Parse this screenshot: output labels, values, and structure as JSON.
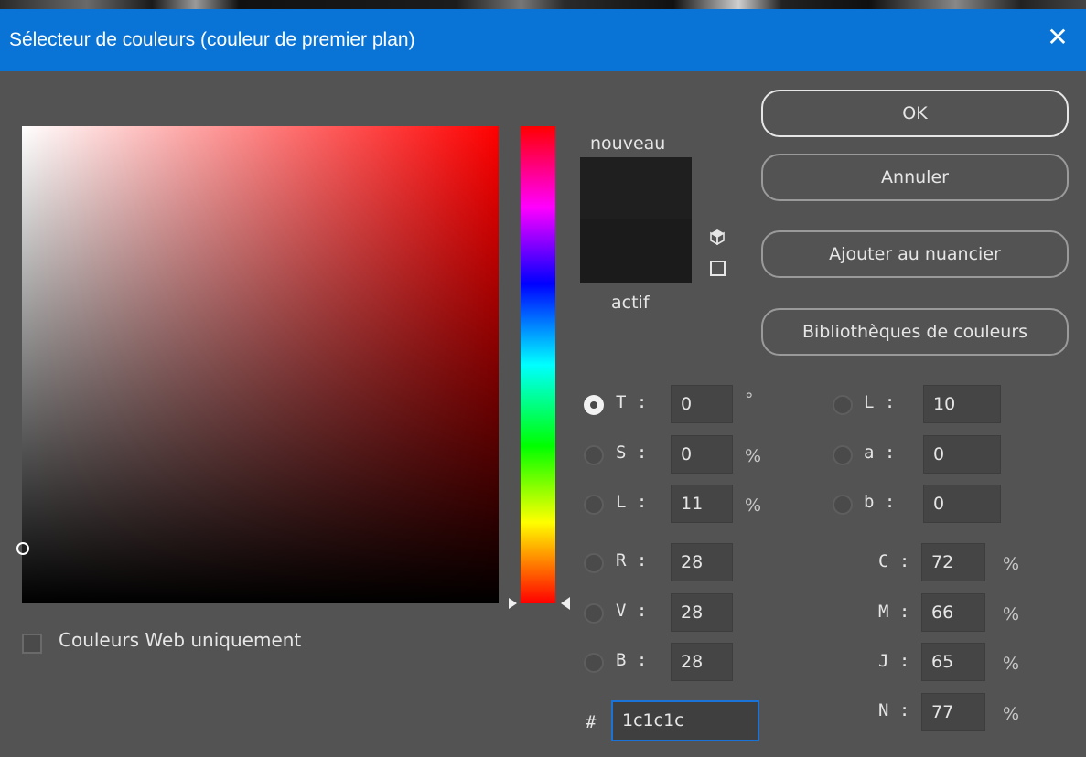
{
  "window": {
    "title": "Sélecteur de couleurs (couleur de premier plan)",
    "close_glyph": "✕",
    "title_bar_color": "#0a74d6"
  },
  "preview": {
    "new_label": "nouveau",
    "current_label": "actif",
    "new_color": "#1f1f1f",
    "current_color": "#1b1b1b",
    "icons": [
      "gamut-warning-cube-icon",
      "web-safe-square-icon"
    ]
  },
  "buttons": {
    "ok": "OK",
    "cancel": "Annuler",
    "add_swatch": "Ajouter au nuancier",
    "libraries": "Bibliothèques de couleurs"
  },
  "hsb": {
    "h": {
      "label": "T :",
      "value": "0",
      "unit": "°",
      "selected": true
    },
    "s": {
      "label": "S :",
      "value": "0",
      "unit": "%",
      "selected": false
    },
    "b": {
      "label": "L :",
      "value": "11",
      "unit": "%",
      "selected": false
    }
  },
  "lab": {
    "l": {
      "label": "L :",
      "value": "10"
    },
    "a": {
      "label": "a :",
      "value": "0"
    },
    "b": {
      "label": "b :",
      "value": "0"
    }
  },
  "rgb": {
    "r": {
      "label": "R :",
      "value": "28"
    },
    "g": {
      "label": "V :",
      "value": "28"
    },
    "b": {
      "label": "B :",
      "value": "28"
    }
  },
  "cmyk": {
    "c": {
      "label": "C :",
      "value": "72",
      "unit": "%"
    },
    "m": {
      "label": "M :",
      "value": "66",
      "unit": "%"
    },
    "y": {
      "label": "J :",
      "value": "65",
      "unit": "%"
    },
    "k": {
      "label": "N :",
      "value": "77",
      "unit": "%"
    }
  },
  "hex": {
    "label": "#",
    "value": "1c1c1c"
  },
  "web_only": {
    "label": "Couleurs Web uniquement",
    "checked": false
  },
  "colors": {
    "dialog_bg": "#535353",
    "hue_selected": "#ff0000",
    "accent": "#1a73d9"
  }
}
